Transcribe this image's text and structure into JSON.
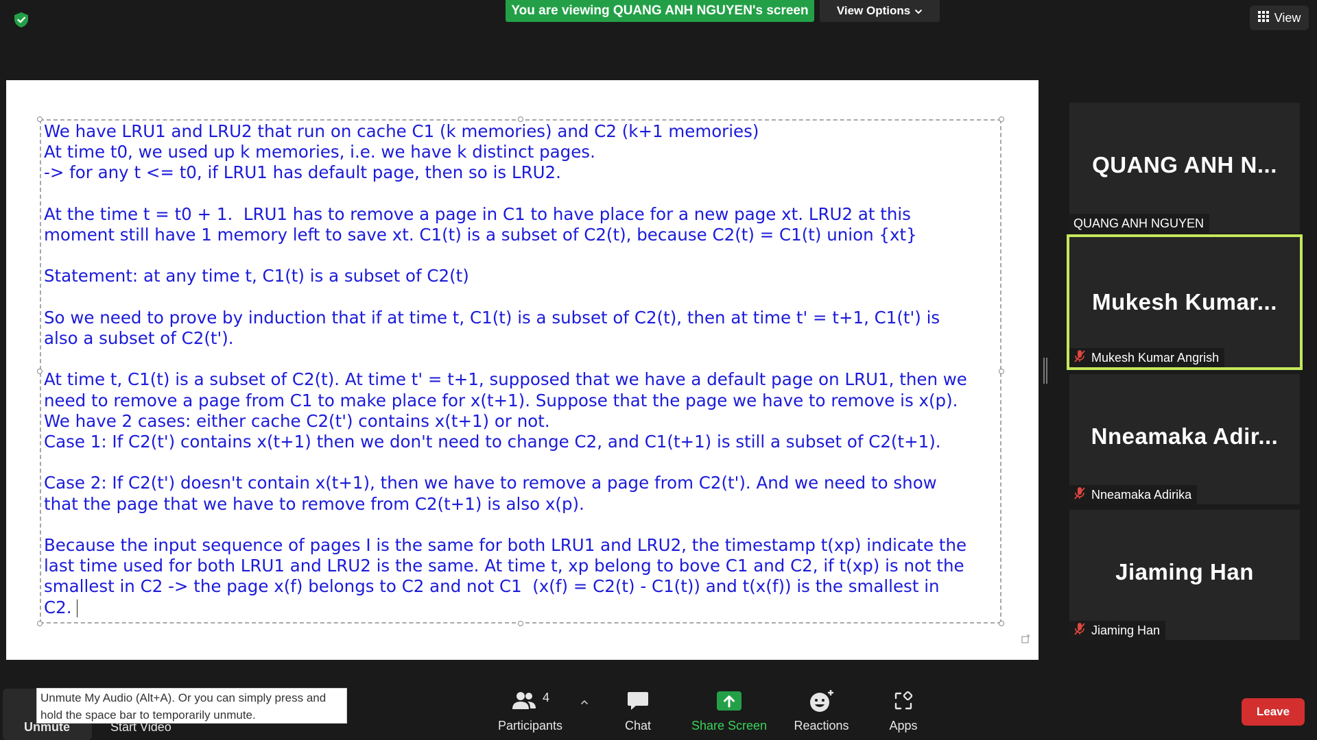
{
  "banner": {
    "viewing_text": "You are viewing QUANG ANH NGUYEN's screen",
    "view_options": "View Options",
    "view_button": "View"
  },
  "document": {
    "text": "We have LRU1 and LRU2 that run on cache C1 (k memories) and C2 (k+1 memories)\nAt time t0, we used up k memories, i.e. we have k distinct pages.\n-> for any t <= t0, if LRU1 has default page, then so is LRU2.\n\nAt the time t = t0 + 1.  LRU1 has to remove a page in C1 to have place for a new page xt. LRU2 at this\nmoment still have 1 memory left to save xt. C1(t) is a subset of C2(t), because C2(t) = C1(t) union {xt}\n\nStatement: at any time t, C1(t) is a subset of C2(t)\n\nSo we need to prove by induction that if at time t, C1(t) is a subset of C2(t), then at time t' = t+1, C1(t') is\nalso a subset of C2(t').\n\nAt time t, C1(t) is a subset of C2(t). At time t' = t+1, supposed that we have a default page on LRU1, then we\nneed to remove a page from C1 to make place for x(t+1). Suppose that the page we have to remove is x(p).\nWe have 2 cases: either cache C2(t') contains x(t+1) or not.\nCase 1: If C2(t') contains x(t+1) then we don't need to change C2, and C1(t+1) is still a subset of C2(t+1).\n\nCase 2: If C2(t') doesn't contain x(t+1), then we have to remove a page from C2(t'). And we need to show\nthat the page that we have to remove from C2(t+1) is also x(p).\n\nBecause the input sequence of pages I is the same for both LRU1 and LRU2, the timestamp t(xp) indicate the\nlast time used for both LRU1 and LRU2 is the same. At time t, xp belong to bove C1 and C2, if t(xp) is not the\nsmallest in C2 -> the page x(f) belongs to C2 and not C1  (x(f) = C2(t) - C1(t)) and t(x(f)) is the smallest in\nC2."
  },
  "participants": [
    {
      "tile_name": "QUANG ANH N...",
      "label": "QUANG ANH NGUYEN",
      "muted": false,
      "active": false
    },
    {
      "tile_name": "Mukesh Kumar...",
      "label": "Mukesh Kumar Angrish",
      "muted": true,
      "active": true
    },
    {
      "tile_name": "Nneamaka Adir...",
      "label": "Nneamaka Adirika",
      "muted": true,
      "active": false
    },
    {
      "tile_name": "Jiaming Han",
      "label": "Jiaming Han",
      "muted": true,
      "active": false
    }
  ],
  "toolbar": {
    "unmute": "Unmute",
    "start_video": "Start Video",
    "tooltip": "Unmute My Audio (Alt+A). Or you can simply press and hold the space bar to temporarily unmute.",
    "participants_label": "Participants",
    "participants_count": "4",
    "chat": "Chat",
    "share_screen": "Share Screen",
    "reactions": "Reactions",
    "apps": "Apps",
    "leave": "Leave"
  },
  "colors": {
    "banner_green": "#23a047",
    "doc_text_blue": "#1b1bd9",
    "active_speaker_border": "#c5e85c",
    "leave_red": "#d32f2f",
    "muted_red": "#e0463f"
  }
}
